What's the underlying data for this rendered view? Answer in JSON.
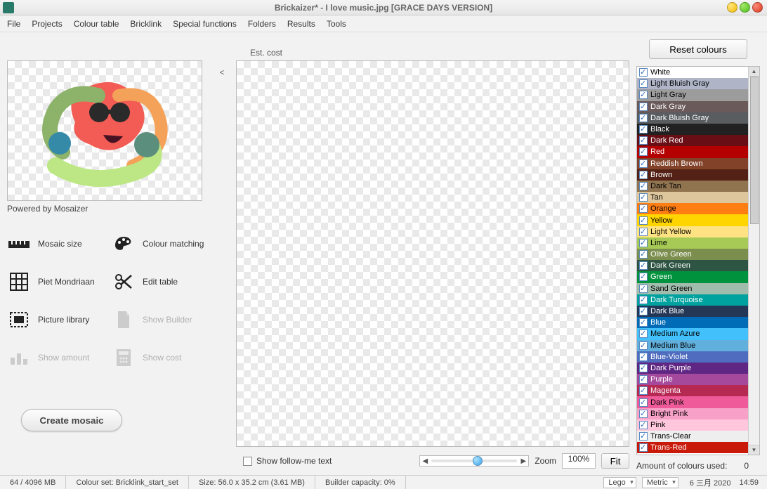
{
  "titlebar": {
    "title": "Brickaizer* - I love music.jpg      [GRACE DAYS VERSION]"
  },
  "menu": {
    "file": "File",
    "projects": "Projects",
    "colour_table": "Colour table",
    "bricklink": "Bricklink",
    "special_functions": "Special functions",
    "folders": "Folders",
    "results": "Results",
    "tools": "Tools"
  },
  "left": {
    "powered": "Powered by Mosaizer",
    "create_button": "Create mosaic",
    "tools": {
      "mosaic_size": "Mosaic size",
      "colour_matching": "Colour matching",
      "piet_mondriaan": "Piet Mondriaan",
      "edit_table": "Edit table",
      "picture_library": "Picture library",
      "show_builder": "Show Builder",
      "show_amount": "Show amount",
      "show_cost": "Show cost"
    }
  },
  "center": {
    "est_cost_label": "Est. cost",
    "divider_arrow": "<",
    "follow_me": "Show follow-me text",
    "zoom_label": "Zoom",
    "zoom_value": "100%",
    "fit_label": "Fit"
  },
  "right": {
    "reset_label": "Reset colours",
    "amount_label": "Amount of colours used:",
    "amount_value": "0",
    "colours": [
      {
        "name": "White",
        "bg": "#ffffff",
        "fg": "#000"
      },
      {
        "name": "Light Bluish Gray",
        "bg": "#afb5c7",
        "fg": "#000"
      },
      {
        "name": "Light Gray",
        "bg": "#9c9c9c",
        "fg": "#000"
      },
      {
        "name": "Dark Gray",
        "bg": "#6b5a5a",
        "fg": "#fff"
      },
      {
        "name": "Dark Bluish Gray",
        "bg": "#595d60",
        "fg": "#fff"
      },
      {
        "name": "Black",
        "bg": "#212121",
        "fg": "#fff"
      },
      {
        "name": "Dark Red",
        "bg": "#6a0e15",
        "fg": "#fff"
      },
      {
        "name": "Red",
        "bg": "#b40000",
        "fg": "#fff"
      },
      {
        "name": "Reddish Brown",
        "bg": "#82422a",
        "fg": "#fff"
      },
      {
        "name": "Brown",
        "bg": "#532115",
        "fg": "#fff"
      },
      {
        "name": "Dark Tan",
        "bg": "#907450",
        "fg": "#000"
      },
      {
        "name": "Tan",
        "bg": "#dec69c",
        "fg": "#000"
      },
      {
        "name": "Orange",
        "bg": "#ff7e14",
        "fg": "#000"
      },
      {
        "name": "Yellow",
        "bg": "#ffd500",
        "fg": "#000"
      },
      {
        "name": "Light Yellow",
        "bg": "#ffe383",
        "fg": "#000"
      },
      {
        "name": "Lime",
        "bg": "#a6ca55",
        "fg": "#000"
      },
      {
        "name": "Olive Green",
        "bg": "#7c8e4e",
        "fg": "#fff"
      },
      {
        "name": "Dark Green",
        "bg": "#2e5543",
        "fg": "#fff"
      },
      {
        "name": "Green",
        "bg": "#00923d",
        "fg": "#fff"
      },
      {
        "name": "Sand Green",
        "bg": "#a0bcac",
        "fg": "#000"
      },
      {
        "name": "Dark Turquoise",
        "bg": "#00a29f",
        "fg": "#fff"
      },
      {
        "name": "Dark Blue",
        "bg": "#243757",
        "fg": "#fff"
      },
      {
        "name": "Blue",
        "bg": "#006cb7",
        "fg": "#fff"
      },
      {
        "name": "Medium Azure",
        "bg": "#42c0fb",
        "fg": "#000"
      },
      {
        "name": "Medium Blue",
        "bg": "#61afdc",
        "fg": "#000"
      },
      {
        "name": "Blue-Violet",
        "bg": "#506cbe",
        "fg": "#fff"
      },
      {
        "name": "Dark Purple",
        "bg": "#5f2683",
        "fg": "#fff"
      },
      {
        "name": "Purple",
        "bg": "#a5499c",
        "fg": "#fff"
      },
      {
        "name": "Magenta",
        "bg": "#b52952",
        "fg": "#fff"
      },
      {
        "name": "Dark Pink",
        "bg": "#ef5b9a",
        "fg": "#000"
      },
      {
        "name": "Bright Pink",
        "bg": "#f7a1c8",
        "fg": "#000"
      },
      {
        "name": "Pink",
        "bg": "#ffc6dc",
        "fg": "#000"
      },
      {
        "name": "Trans-Clear",
        "bg": "#eeeeee",
        "fg": "#000"
      },
      {
        "name": "Trans-Red",
        "bg": "#c91a09",
        "fg": "#fff"
      }
    ]
  },
  "status": {
    "memory": "64 / 4096 MB",
    "colour_set": "Colour set: Bricklink_start_set",
    "size": "Size: 56.0 x 35.2 cm (3.61 MB)",
    "builder_capacity": "Builder capacity: 0%",
    "brand_select": "Lego",
    "units_select": "Metric",
    "date": "6 三月 2020",
    "time": "14:59"
  }
}
